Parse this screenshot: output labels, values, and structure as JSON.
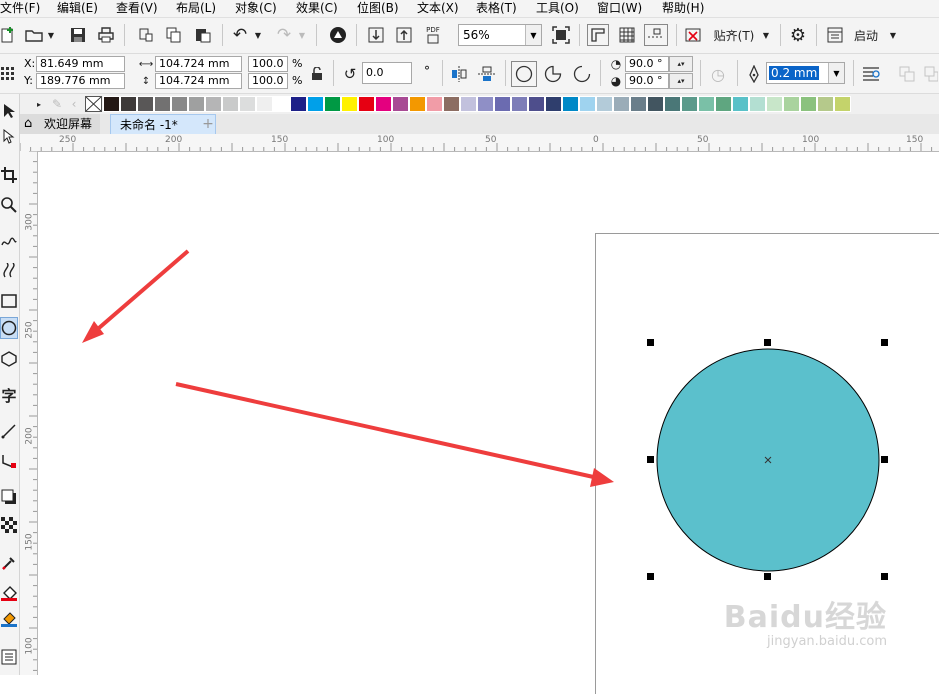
{
  "menu": [
    "文件(F)",
    "编辑(E)",
    "查看(V)",
    "布局(L)",
    "对象(C)",
    "效果(C)",
    "位图(B)",
    "文本(X)",
    "表格(T)",
    "工具(O)",
    "窗口(W)",
    "帮助(H)"
  ],
  "toolbar": {
    "zoom_value": "56%",
    "snap_label": "贴齐(T)",
    "launch_label": "启动",
    "pdf_label": "PDF"
  },
  "property_bar": {
    "x_label": "X:",
    "x_value": "81.649 mm",
    "y_label": "Y:",
    "y_value": "189.776 mm",
    "width_value": "104.724 mm",
    "height_value": "104.724 mm",
    "scale_w": "100.0",
    "scale_h": "100.0",
    "percent": "%",
    "rotation": "0.0",
    "degree": "°",
    "start_angle": "90.0 °",
    "end_angle": "90.0 °",
    "outline_width": "0.2 mm"
  },
  "palette_colors": [
    "#231815",
    "#3e3a39",
    "#595757",
    "#727171",
    "#898989",
    "#9fa0a0",
    "#b5b5b6",
    "#c9caca",
    "#dcdddd",
    "#efefef",
    "#ffffff",
    "#1d2088",
    "#00a0e9",
    "#009944",
    "#fff100",
    "#e60012",
    "#e4007f",
    "#a84a94",
    "#f39800",
    "#f19ca7",
    "#8c6d62",
    "#c2c1dd",
    "#8f8fc6",
    "#6b6bb0",
    "#7d7db8",
    "#4e4e8c",
    "#2f3e6d",
    "#0089c7",
    "#9fd3ef",
    "#b3cbd9",
    "#9aacb8",
    "#6a7e8a",
    "#425560",
    "#4a7777",
    "#5b9a8b",
    "#7ac0a7",
    "#5fa680",
    "#59c1c8",
    "#b3dfd2",
    "#c8e6c9",
    "#a9d39e",
    "#8bc27e",
    "#b5c98b",
    "#c4d36b"
  ],
  "tabs": {
    "welcome": "欢迎屏幕",
    "document": "未命名 -1*",
    "add": "+"
  },
  "ruler": {
    "h_labels": [
      "250",
      "200",
      "150",
      "100",
      "50",
      "0",
      "50",
      "100",
      "150"
    ],
    "v_labels": [
      "300",
      "250",
      "200",
      "150",
      "100"
    ]
  },
  "shape": {
    "type": "ellipse",
    "fill": "#5bc0cc",
    "stroke": "#000000"
  },
  "annotation_color": "#ee3d3d",
  "watermark": {
    "main": "Baidu经验",
    "sub": "jingyan.baidu.com"
  }
}
